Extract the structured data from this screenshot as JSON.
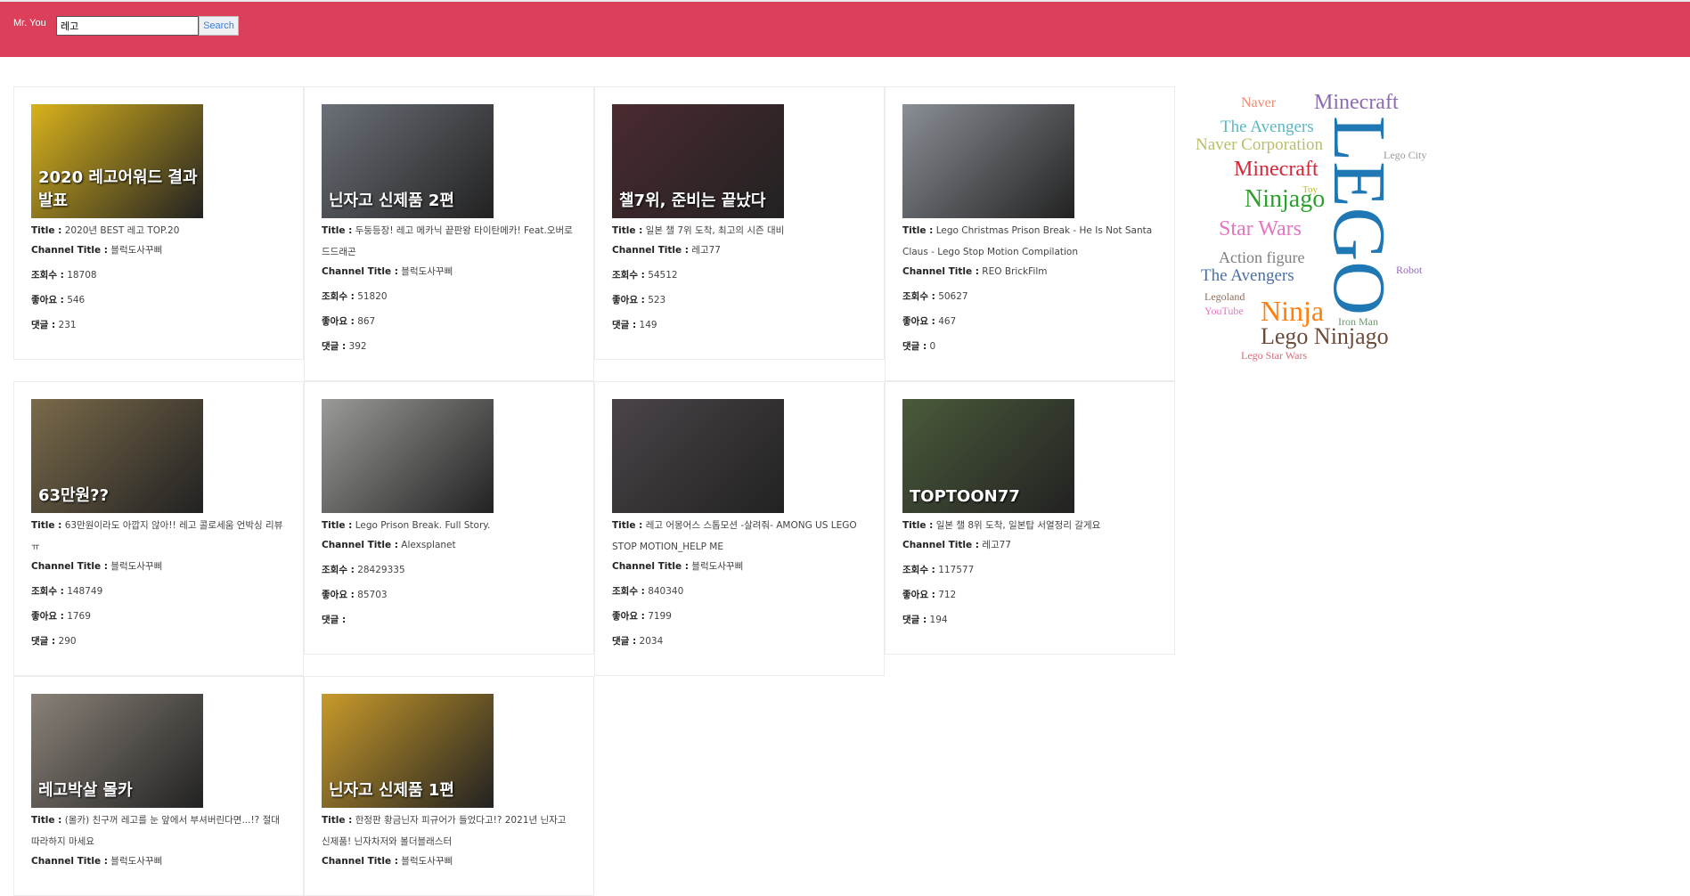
{
  "header": {
    "brand": "Mr. You",
    "search_value": "레고",
    "search_button": "Search",
    "bg": "#dc3f5a"
  },
  "labels": {
    "title": "Title :",
    "channel": "Channel Title :",
    "views": "조회수 :",
    "likes": "좋아요 :",
    "comments": "댓글 :"
  },
  "videos": [
    {
      "title": "2020년 BEST 레고 TOP.20",
      "channel": "블럭도사꾸삐",
      "views": "18708",
      "likes": "546",
      "comments": "231",
      "thumb_text": "2020 레고어워드 결과발표",
      "thumb_color": "#d8b21c"
    },
    {
      "title": "두둥등장! 레고 메카닉 끝판왕 타이탄메카! Feat.오버로드드래곤",
      "channel": "블럭도사꾸삐",
      "views": "51820",
      "likes": "867",
      "comments": "392",
      "thumb_text": "닌자고 신제품 2편",
      "thumb_color": "#6b7078"
    },
    {
      "title": "일본 챌 7위 도착, 최고의 시즌 대비",
      "channel": "레고77",
      "views": "54512",
      "likes": "523",
      "comments": "149",
      "thumb_text": "챌7위, 준비는 끝났다",
      "thumb_color": "#4a2a30"
    },
    {
      "title": "Lego Christmas Prison Break - He Is Not Santa Claus - Lego Stop Motion Compilation",
      "channel": "REO BrickFilm",
      "views": "50627",
      "likes": "467",
      "comments": "0",
      "thumb_text": "",
      "thumb_color": "#8a8f96"
    },
    {
      "title": "63만원이라도 아깝지 않아!! 레고 콜로세움 언박싱 리뷰 ㅠ",
      "channel": "블럭도사꾸삐",
      "views": "148749",
      "likes": "1769",
      "comments": "290",
      "thumb_text": "63만원??",
      "thumb_color": "#7a6a4a"
    },
    {
      "title": "Lego Prison Break. Full Story.",
      "channel": "Alexsplanet",
      "views": "28429335",
      "likes": "85703",
      "comments": "",
      "thumb_text": "",
      "thumb_color": "#9a9a98"
    },
    {
      "title": "레고 어몽어스 스톱모션 -살려줘- AMONG US LEGO STOP MOTION_HELP ME",
      "channel": "블럭도사꾸삐",
      "views": "840340",
      "likes": "7199",
      "comments": "2034",
      "thumb_text": "",
      "thumb_color": "#4a4448"
    },
    {
      "title": "일본 챌 8위 도착, 일본탑 서열정리 갈게요",
      "channel": "레고77",
      "views": "117577",
      "likes": "712",
      "comments": "194",
      "thumb_text": "TOPTOON77",
      "thumb_color": "#4a5a3a"
    },
    {
      "title": "(몰카) 친구꺼 레고를 눈 앞에서 부셔버린다면...!? 절대 따라하지 마세요",
      "channel": "블럭도사꾸삐",
      "thumb_text": "레고박살 몰카",
      "thumb_color": "#8a8278"
    },
    {
      "title": "한정판 황금닌자 피규어가 들었다고!? 2021년 닌자고 신제품! 닌자차저와 볼더블래스터",
      "channel": "블럭도사꾸삐",
      "thumb_text": "닌자고 신제품 1편",
      "thumb_color": "#c89a2a"
    }
  ],
  "wordcloud": [
    {
      "text": "LEGO",
      "color": "#1f77b4"
    },
    {
      "text": "Naver",
      "color": "#f08a6a"
    },
    {
      "text": "Minecraft",
      "color": "#8c6bb1"
    },
    {
      "text": "The Avengers",
      "color": "#5bb8c0"
    },
    {
      "text": "Naver Corporation",
      "color": "#bcbd6a"
    },
    {
      "text": "Lego City",
      "color": "#999999"
    },
    {
      "text": "Minecraft",
      "color": "#d62738"
    },
    {
      "text": "Toy",
      "color": "#bcbd22"
    },
    {
      "text": "Ninjago",
      "color": "#2ca02c"
    },
    {
      "text": "Star Wars",
      "color": "#e377c2"
    },
    {
      "text": "Action figure",
      "color": "#7f7f7f"
    },
    {
      "text": "The Avengers",
      "color": "#4a6fa5"
    },
    {
      "text": "Robot",
      "color": "#9467bd"
    },
    {
      "text": "Legoland",
      "color": "#8c6d5a"
    },
    {
      "text": "YouTube",
      "color": "#e377c2"
    },
    {
      "text": "Ninja",
      "color": "#ff7f0e"
    },
    {
      "text": "Iron Man",
      "color": "#6a9a6a"
    },
    {
      "text": "Lego Ninjago",
      "color": "#6b4c3b"
    },
    {
      "text": "Lego Star Wars",
      "color": "#d66a7a"
    }
  ]
}
